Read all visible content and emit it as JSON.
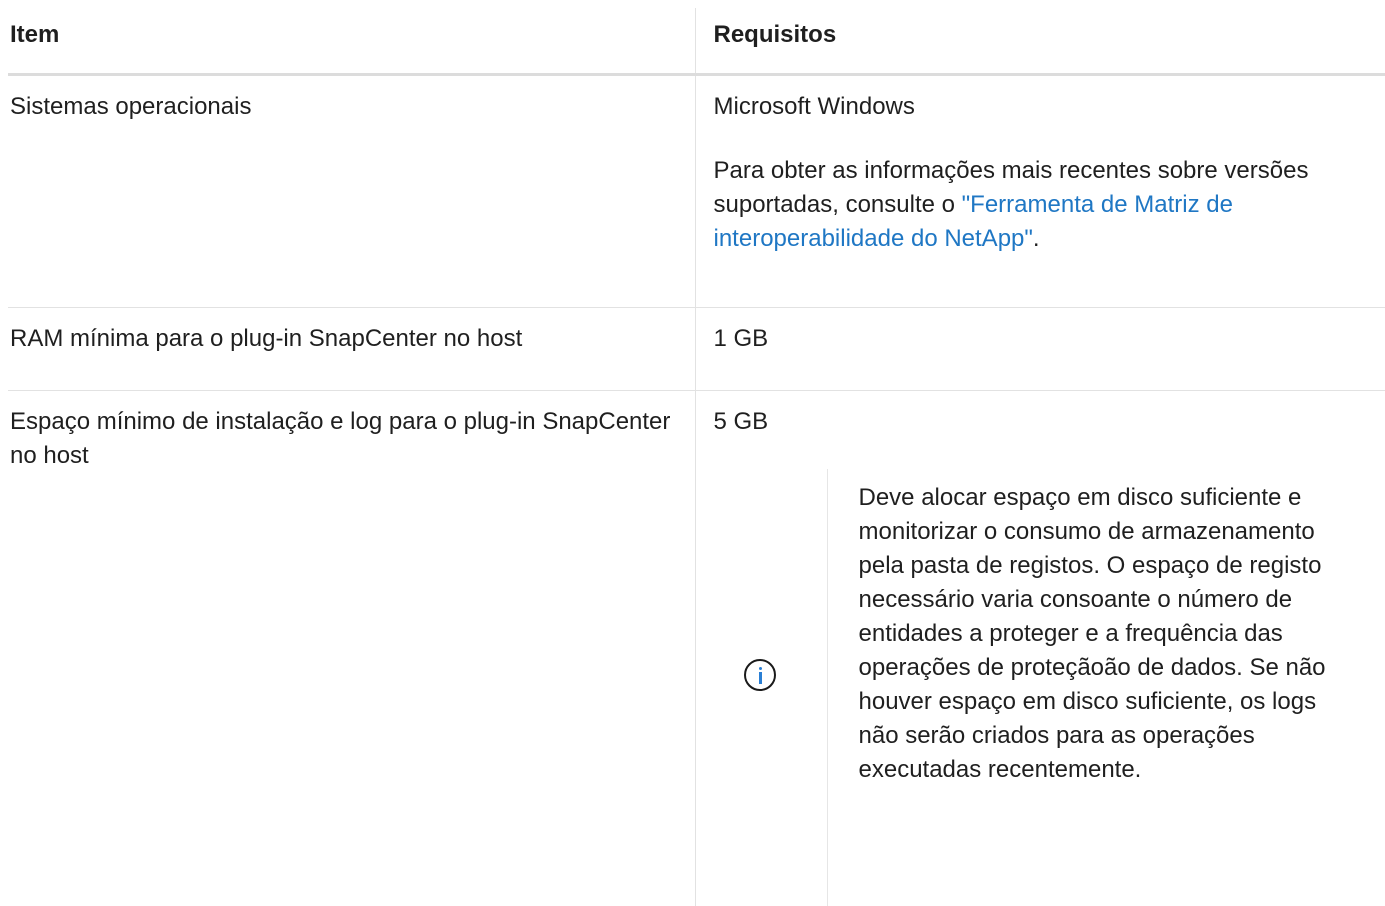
{
  "table": {
    "headers": {
      "item": "Item",
      "requirements": "Requisitos"
    },
    "rows": [
      {
        "item": "Sistemas operacionais",
        "value": "Microsoft Windows",
        "detail_prefix": "Para obter as informações mais recentes sobre versões suportadas, consulte o ",
        "detail_link": "\"Ferramenta de Matriz de interoperabilidade do NetApp\"",
        "detail_suffix": "."
      },
      {
        "item": "RAM mínima para o plug-in SnapCenter no host",
        "value": "1 GB"
      },
      {
        "item": "Espaço mínimo de instalação e log para o plug-in SnapCenter no host",
        "value": "5 GB",
        "note": {
          "icon": "info-circle-icon",
          "icon_color": "#2a7fd4",
          "text": "Deve alocar espaço em disco suficiente e monitorizar o consumo de armazenamento pela pasta de registos. O espaço de registo necessário varia consoante o número de entidades a proteger e a frequência das operações de proteçãoão de dados. Se não houver espaço em disco suficiente, os logs não serão criados para as operações executadas recentemente."
        }
      }
    ]
  },
  "colors": {
    "link": "#1f77c4",
    "text": "#1f1f1f",
    "border": "#e2e2e2"
  }
}
